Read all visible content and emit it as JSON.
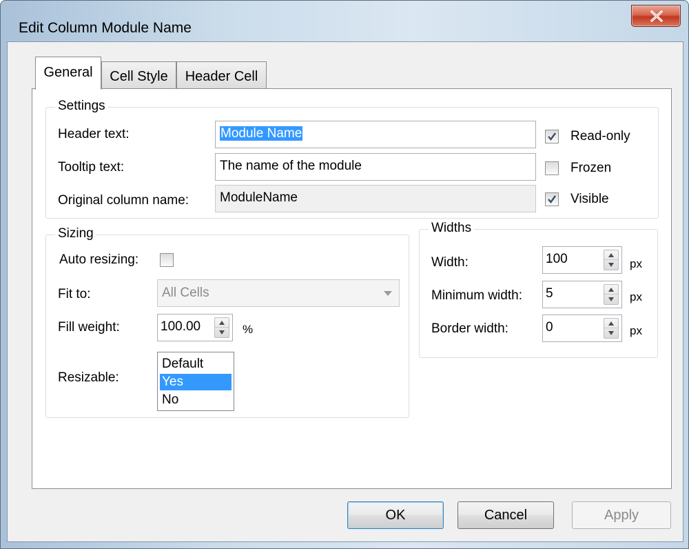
{
  "window": {
    "title": "Edit Column Module Name"
  },
  "tabs": [
    {
      "label": "General",
      "active": true
    },
    {
      "label": "Cell Style",
      "active": false
    },
    {
      "label": "Header Cell",
      "active": false
    }
  ],
  "settings": {
    "group_label": "Settings",
    "header_text_label": "Header text:",
    "header_text_value": "Module Name",
    "tooltip_text_label": "Tooltip text:",
    "tooltip_text_value": "The name of the module",
    "original_column_label": "Original column name:",
    "original_column_value": "ModuleName",
    "readonly_label": "Read-only",
    "readonly_checked": true,
    "frozen_label": "Frozen",
    "frozen_checked": false,
    "visible_label": "Visible",
    "visible_checked": true
  },
  "sizing": {
    "group_label": "Sizing",
    "auto_resizing_label": "Auto resizing:",
    "auto_resizing_checked": false,
    "fit_to_label": "Fit to:",
    "fit_to_value": "All Cells",
    "fill_weight_label": "Fill weight:",
    "fill_weight_value": "100.00",
    "fill_weight_unit": "%",
    "resizable_label": "Resizable:",
    "resizable_options": [
      "Default",
      "Yes",
      "No"
    ],
    "resizable_selected": "Yes"
  },
  "widths": {
    "group_label": "Widths",
    "width_label": "Width:",
    "width_value": "100",
    "width_unit": "px",
    "min_width_label": "Minimum width:",
    "min_width_value": "5",
    "min_width_unit": "px",
    "border_width_label": "Border width:",
    "border_width_value": "0",
    "border_width_unit": "px"
  },
  "buttons": {
    "ok": "OK",
    "cancel": "Cancel",
    "apply": "Apply"
  }
}
